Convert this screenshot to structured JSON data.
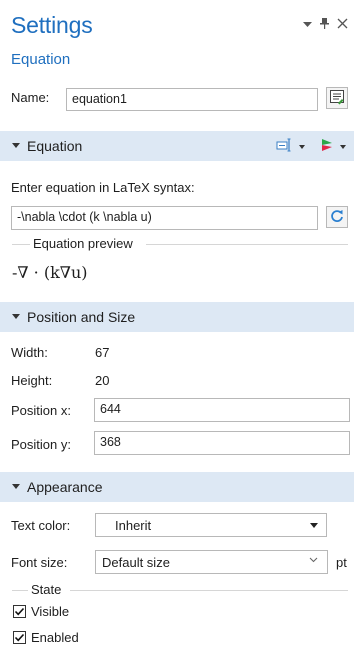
{
  "window": {
    "title": "Settings",
    "subtitle": "Equation",
    "controls": [
      "dropdown-arrow",
      "pin-icon",
      "close-icon"
    ]
  },
  "name_field": {
    "label": "Name:",
    "value": "equation1"
  },
  "equation_section": {
    "header": "Equation",
    "latex_label": "Enter equation in LaTeX syntax:",
    "latex_value": "-\\nabla \\cdot (k \\nabla u)",
    "preview_group": "Equation preview",
    "preview_text": "-∇ · (k∇u)"
  },
  "position_section": {
    "header": "Position and Size",
    "width_label": "Width:",
    "width_value": "67",
    "height_label": "Height:",
    "height_value": "20",
    "pos_x_label": "Position x:",
    "pos_x_value": "644",
    "pos_y_label": "Position y:",
    "pos_y_value": "368"
  },
  "appearance_section": {
    "header": "Appearance",
    "text_color_label": "Text color:",
    "text_color_value": "Inherit",
    "font_size_label": "Font size:",
    "font_size_value": "Default size",
    "font_size_unit": "pt",
    "state_group": "State",
    "visible_label": "Visible",
    "visible_checked": true,
    "enabled_label": "Enabled",
    "enabled_checked": true
  },
  "colors": {
    "accent": "#1f6fbf",
    "section_bg": "#dde8f4"
  }
}
